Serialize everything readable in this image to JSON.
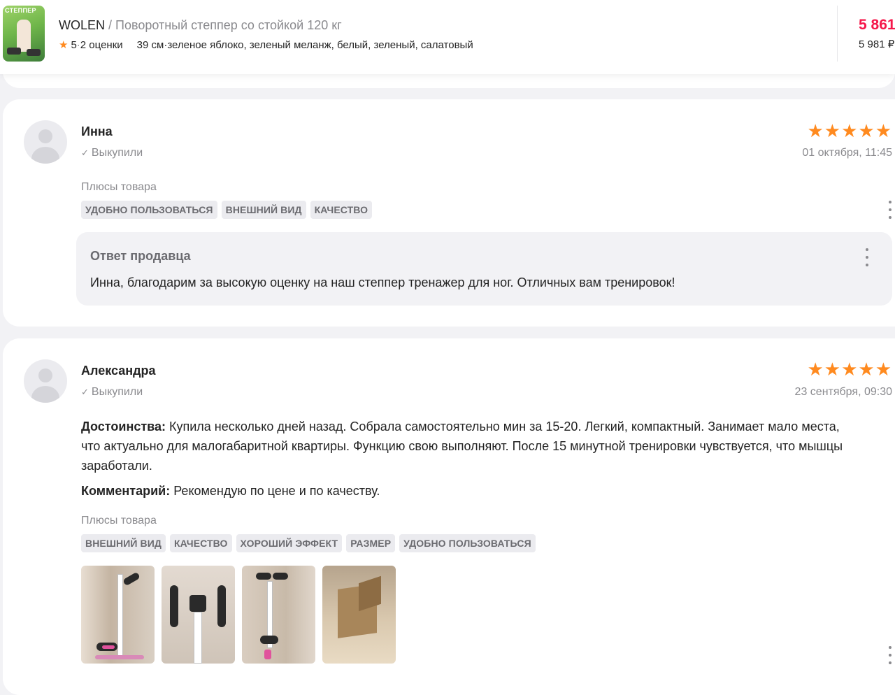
{
  "header": {
    "thumb_text": "СТЕППЕР",
    "brand": "WOLEN",
    "separator": " / ",
    "product_name": "Поворотный степпер со стойкой 120 кг",
    "rating": "5",
    "rating_dot": " · ",
    "ratings_count": "2 оценки",
    "size": "39 см",
    "colors_dot": " · ",
    "colors": "зеленое яблоко, зеленый меланж, белый, зеленый, салатовый",
    "price": "5 861",
    "price_old": "5 981 ₽",
    "accent_color": "#f5174a",
    "star_color": "#ff8a1f"
  },
  "reviews": [
    {
      "author": "Инна",
      "bought_label": "Выкупили",
      "stars": "★★★★★",
      "rating": 5,
      "date": "01 октября, 11:45",
      "pros_title": "Плюсы товара",
      "tags": [
        "УДОБНО ПОЛЬЗОВАТЬСЯ",
        "ВНЕШНИЙ ВИД",
        "КАЧЕСТВО"
      ],
      "seller_reply": {
        "title": "Ответ продавца",
        "text": "Инна, благодарим за высокую оценку на наш степпер тренажер для ног. Отличных вам тренировок!"
      }
    },
    {
      "author": "Александра",
      "bought_label": "Выкупили",
      "stars": "★★★★★",
      "rating": 5,
      "date": "23 сентября, 09:30",
      "advantages_label": "Достоинства:",
      "advantages_text": " Купила несколько дней назад. Собрала самостоятельно мин за 15-20. Легкий, компактный. Занимает мало места, что актуально для малогабаритной квартиры. Функцию свою выполняют. После 15 минутной тренировки чувствуется, что мышцы заработали.",
      "comment_label": "Комментарий:",
      "comment_text": " Рекомендую по цене и по качеству.",
      "pros_title": "Плюсы товара",
      "tags": [
        "ВНЕШНИЙ ВИД",
        "КАЧЕСТВО",
        "ХОРОШИЙ ЭФФЕКТ",
        "РАЗМЕР",
        "УДОБНО ПОЛЬЗОВАТЬСЯ"
      ],
      "photos": [
        "stepper-photo",
        "stepper-console-photo",
        "stepper-photo",
        "cardboard-box-photo"
      ]
    }
  ]
}
